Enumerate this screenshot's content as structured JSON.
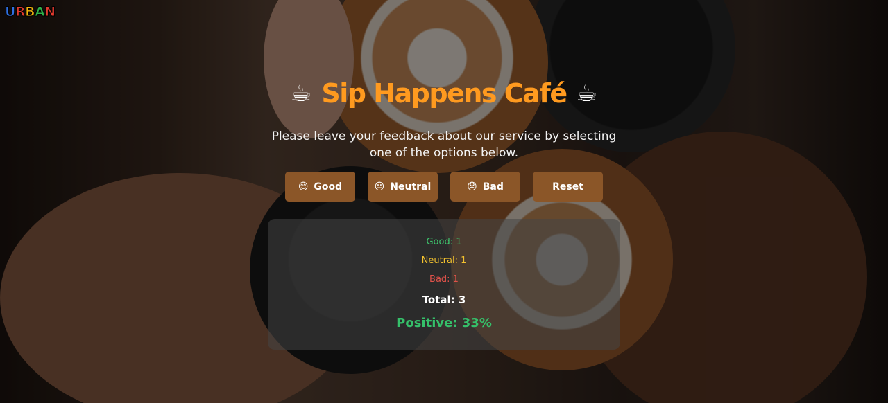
{
  "logo": {
    "letters": [
      "U",
      "R",
      "B",
      "A",
      "N"
    ],
    "colors": [
      "#2f6fe0",
      "#e23b2e",
      "#f3b60d",
      "#2fb24a",
      "#e23b2e"
    ]
  },
  "header": {
    "icon_left": "☕",
    "title": "Sip Happens Café",
    "icon_right": "☕",
    "subtitle": "Please leave your feedback about our service by selecting one of the options below."
  },
  "buttons": {
    "good": {
      "emoji": "😊",
      "label": "Good"
    },
    "neutral": {
      "emoji": "😐",
      "label": "Neutral"
    },
    "bad": {
      "emoji": "😞",
      "label": "Bad"
    },
    "reset": {
      "label": "Reset"
    }
  },
  "stats": {
    "good": "Good: 1",
    "neutral": "Neutral: 1",
    "bad": "Bad: 1",
    "total": "Total: 3",
    "positive": "Positive: 33%"
  },
  "colors": {
    "accent": "#ff9a1f",
    "button_bg": "#8b5628",
    "good": "#3ec46d",
    "neutral": "#f2c12e",
    "bad": "#e0524a",
    "positive": "#35c06a"
  }
}
